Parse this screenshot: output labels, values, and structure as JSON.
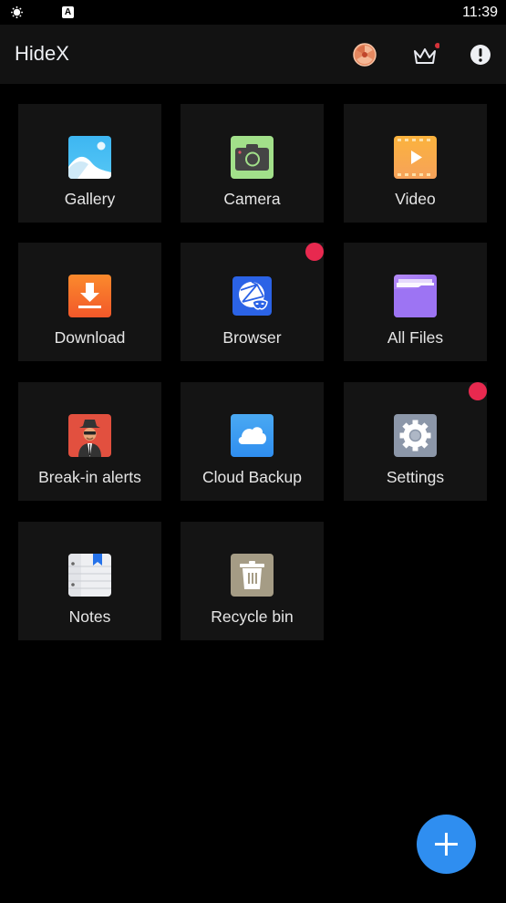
{
  "status_bar": {
    "time": "11:39",
    "icons": [
      "brightness-icon",
      "a-notification-icon"
    ],
    "a_icon_letter": "A"
  },
  "app_bar": {
    "title": "HideX",
    "actions": [
      {
        "name": "theme-disc-icon",
        "color": "#e58860"
      },
      {
        "name": "crown-premium-icon",
        "has_badge": true,
        "badge_color": "#d6333a"
      },
      {
        "name": "info-alert-icon"
      }
    ]
  },
  "tiles": [
    {
      "label": "Gallery",
      "icon": "gallery-icon",
      "badge": false
    },
    {
      "label": "Camera",
      "icon": "camera-icon",
      "badge": false
    },
    {
      "label": "Video",
      "icon": "video-icon",
      "badge": false
    },
    {
      "label": "Download",
      "icon": "download-icon",
      "badge": false
    },
    {
      "label": "Browser",
      "icon": "browser-icon",
      "badge": true
    },
    {
      "label": "All Files",
      "icon": "folder-icon",
      "badge": false
    },
    {
      "label": "Break-in alerts",
      "icon": "intruder-icon",
      "badge": false
    },
    {
      "label": "Cloud Backup",
      "icon": "cloud-icon",
      "badge": false
    },
    {
      "label": "Settings",
      "icon": "gear-icon",
      "badge": true
    },
    {
      "label": "Notes",
      "icon": "notes-icon",
      "badge": false
    },
    {
      "label": "Recycle bin",
      "icon": "trash-icon",
      "badge": false
    }
  ],
  "fab": {
    "icon": "plus-icon",
    "color": "#2f8ef0"
  },
  "colors": {
    "badge": "#e8294f",
    "tile_bg": "#141414",
    "appbar_bg": "#121212"
  }
}
